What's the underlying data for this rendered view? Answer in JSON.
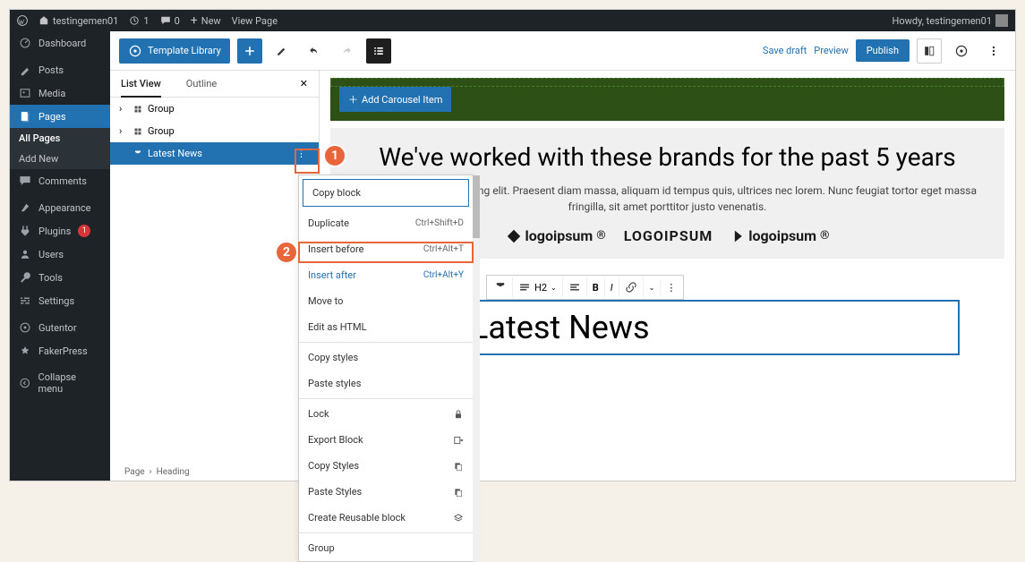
{
  "adminbar": {
    "site": "testingemen01",
    "updates": "1",
    "comments": "0",
    "new": "New",
    "viewpage": "View Page",
    "howdy": "Howdy, testingemen01"
  },
  "sidebar": {
    "dashboard": "Dashboard",
    "posts": "Posts",
    "media": "Media",
    "pages": "Pages",
    "allpages": "All Pages",
    "addnew": "Add New",
    "comments": "Comments",
    "appearance": "Appearance",
    "plugins": "Plugins",
    "plugins_badge": "1",
    "users": "Users",
    "tools": "Tools",
    "settings": "Settings",
    "gutentor": "Gutentor",
    "fakerpress": "FakerPress",
    "collapse": "Collapse menu"
  },
  "editorbar": {
    "template": "Template Library",
    "savedraft": "Save draft",
    "preview": "Preview",
    "publish": "Publish"
  },
  "listpanel": {
    "tab1": "List View",
    "tab2": "Outline",
    "group": "Group",
    "latestnews": "Latest News",
    "crumb1": "Page",
    "crumb2": "Heading"
  },
  "canvas": {
    "addcarousel": "Add Carousel Item",
    "brands_h": "We've worked with these brands for the past 5 years",
    "brands_p": "met, consectetur adipiscing elit. Praesent diam massa, aliquam id tempus quis, ultrices nec lorem. Nunc feugiat tortor eget massa fringilla, sit amet porttitor justo venenatis.",
    "logos": [
      "logoipsum",
      "LOGOIPSUM",
      "logoipsum"
    ],
    "heading": "Latest News",
    "toolbar": {
      "h2": "H2",
      "bold": "B",
      "italic": "I"
    }
  },
  "ctx": {
    "copy": "Copy block",
    "duplicate": "Duplicate",
    "duplicate_sc": "Ctrl+Shift+D",
    "insertbefore": "Insert before",
    "insertbefore_sc": "Ctrl+Alt+T",
    "insertafter": "Insert after",
    "insertafter_sc": "Ctrl+Alt+Y",
    "moveto": "Move to",
    "edithtml": "Edit as HTML",
    "copystyles": "Copy styles",
    "pastestyles": "Paste styles",
    "lock": "Lock",
    "export": "Export Block",
    "copystyles2": "Copy Styles",
    "pastestyles2": "Paste Styles",
    "reusable": "Create Reusable block",
    "group": "Group"
  },
  "callouts": {
    "one": "1",
    "two": "2"
  }
}
